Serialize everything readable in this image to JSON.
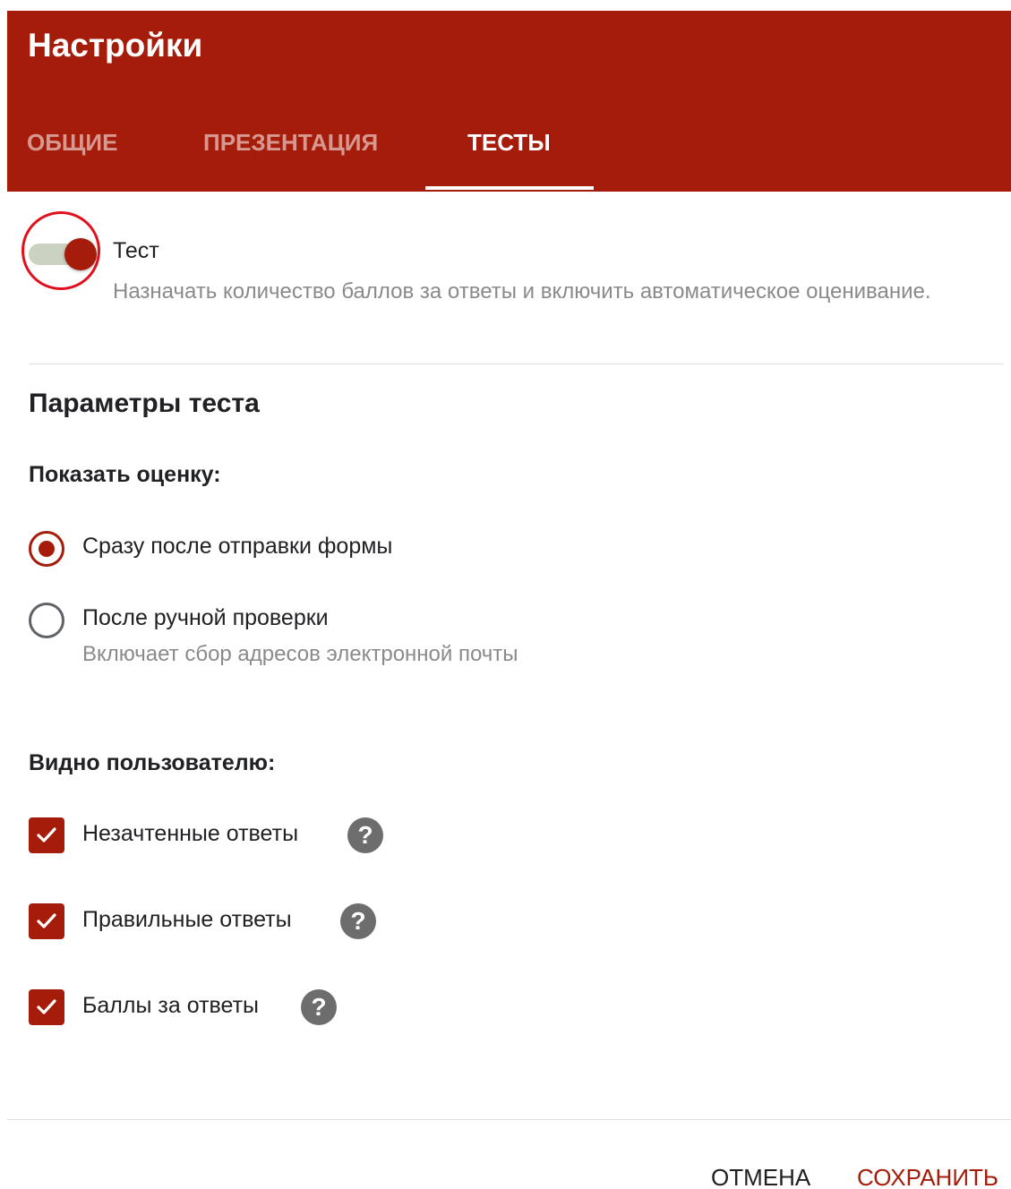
{
  "header": {
    "title": "Настройки",
    "tabs": [
      {
        "label": "ОБЩИЕ",
        "active": false
      },
      {
        "label": "ПРЕЗЕНТАЦИЯ",
        "active": false
      },
      {
        "label": "ТЕСТЫ",
        "active": true
      }
    ]
  },
  "quiz_toggle": {
    "label": "Тест",
    "description": "Назначать количество баллов за ответы и включить автоматическое оценивание.",
    "on": true
  },
  "section": {
    "title": "Параметры теста"
  },
  "show_grade": {
    "label": "Показать оценку:",
    "options": [
      {
        "label": "Сразу после отправки формы",
        "selected": true,
        "description": ""
      },
      {
        "label": "После ручной проверки",
        "selected": false,
        "description": "Включает сбор адресов электронной почты"
      }
    ]
  },
  "visible_to_user": {
    "label": "Видно пользователю:",
    "items": [
      {
        "label": "Незачтенные ответы",
        "checked": true,
        "icon": "help-icon"
      },
      {
        "label": "Правильные ответы",
        "checked": true,
        "icon": "help-icon"
      },
      {
        "label": "Баллы за ответы",
        "checked": true,
        "icon": "help-icon"
      }
    ]
  },
  "footer": {
    "cancel_label": "ОТМЕНА",
    "save_label": "СОХРАНИТЬ"
  },
  "colors": {
    "accent": "#a51c0a",
    "highlight_ring": "#e0101d",
    "toggle_track": "#ccd2c2"
  },
  "help_glyph": "?"
}
